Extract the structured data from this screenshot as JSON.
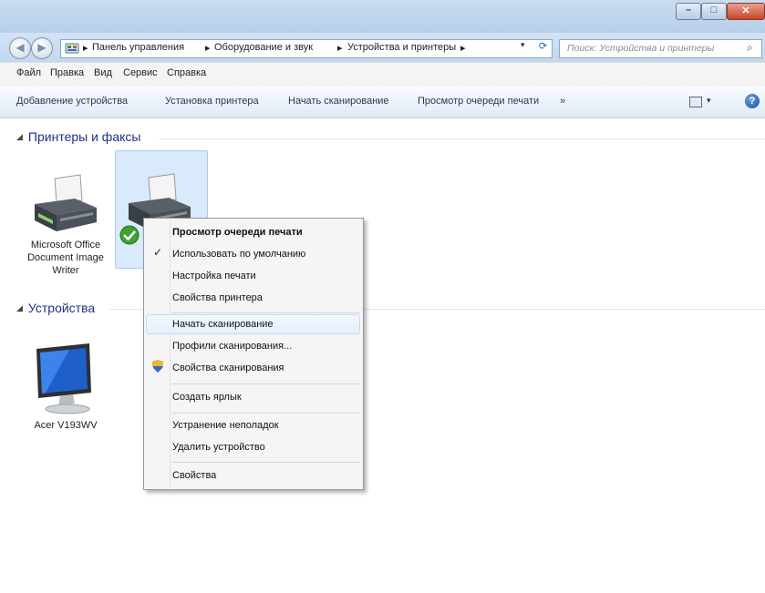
{
  "window": {
    "caption_buttons": {
      "minimize": "–",
      "maximize": "□",
      "close": "✕"
    }
  },
  "nav": {
    "back": "◀",
    "forward": "▶",
    "breadcrumb": [
      "Панель управления",
      "Оборудование и звук",
      "Устройства и принтеры"
    ],
    "crumb_sep": "▸",
    "dropdown": "▾",
    "refresh": "⟳",
    "search_placeholder": "Поиск: Устройства и принтеры",
    "search_icon": "⌕"
  },
  "menubar": [
    "Файл",
    "Правка",
    "Вид",
    "Сервис",
    "Справка"
  ],
  "commandbar": {
    "items": [
      "Добавление устройства",
      "Установка принтера",
      "Начать сканирование",
      "Просмотр очереди печати"
    ],
    "overflow": "»",
    "view_dropdown": "▾",
    "help": "?"
  },
  "groups": {
    "printers": {
      "title": "Принтеры и факсы",
      "devices": [
        {
          "label": [
            "Microsoft Office",
            "Document Image",
            "Writer"
          ],
          "icon": "printer-icon"
        },
        {
          "label": [],
          "icon": "printer-icon",
          "default": true,
          "selected": true
        }
      ]
    },
    "devices": {
      "title": "Устройства",
      "devices": [
        {
          "label": [
            "Acer V193WV"
          ],
          "icon": "monitor-icon"
        }
      ]
    }
  },
  "context_menu": {
    "items": [
      {
        "label": "Просмотр очереди печати",
        "bold": true
      },
      {
        "label": "Использовать по умолчанию",
        "checked": true
      },
      {
        "label": "Настройка печати"
      },
      {
        "label": "Свойства принтера"
      },
      {
        "label": "Начать сканирование",
        "hovered": true
      },
      {
        "label": "Профили сканирования..."
      },
      {
        "label": "Свойства сканирования",
        "icon": "shield-icon"
      },
      {
        "label": "Создать ярлык"
      },
      {
        "label": "Устранение неполадок"
      },
      {
        "label": "Удалить устройство"
      },
      {
        "label": "Свойства"
      }
    ],
    "check": "✓"
  },
  "colors": {
    "accent": "#1e3287",
    "selection": "#d8eafb",
    "titlebar": "#c3d7ee"
  }
}
